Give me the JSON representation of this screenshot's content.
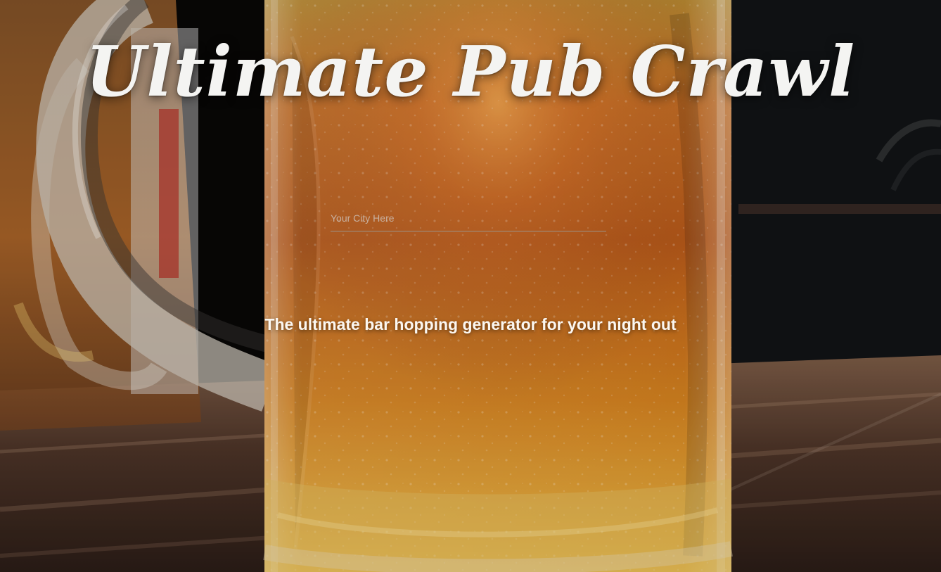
{
  "page": {
    "title": "Ultimate Pub Crawl",
    "tagline": "The ultimate bar hopping generator for your night out",
    "background_icon": "beer-mug-photo"
  },
  "search": {
    "placeholder": "Your City Here",
    "value": ""
  },
  "colors": {
    "text": "#f4f4f2",
    "tagline": "#fbf7f1",
    "input_border": "#9b948c",
    "placeholder": "#cdbfb5",
    "beer": "#c8731f",
    "background": "#0b0906"
  }
}
